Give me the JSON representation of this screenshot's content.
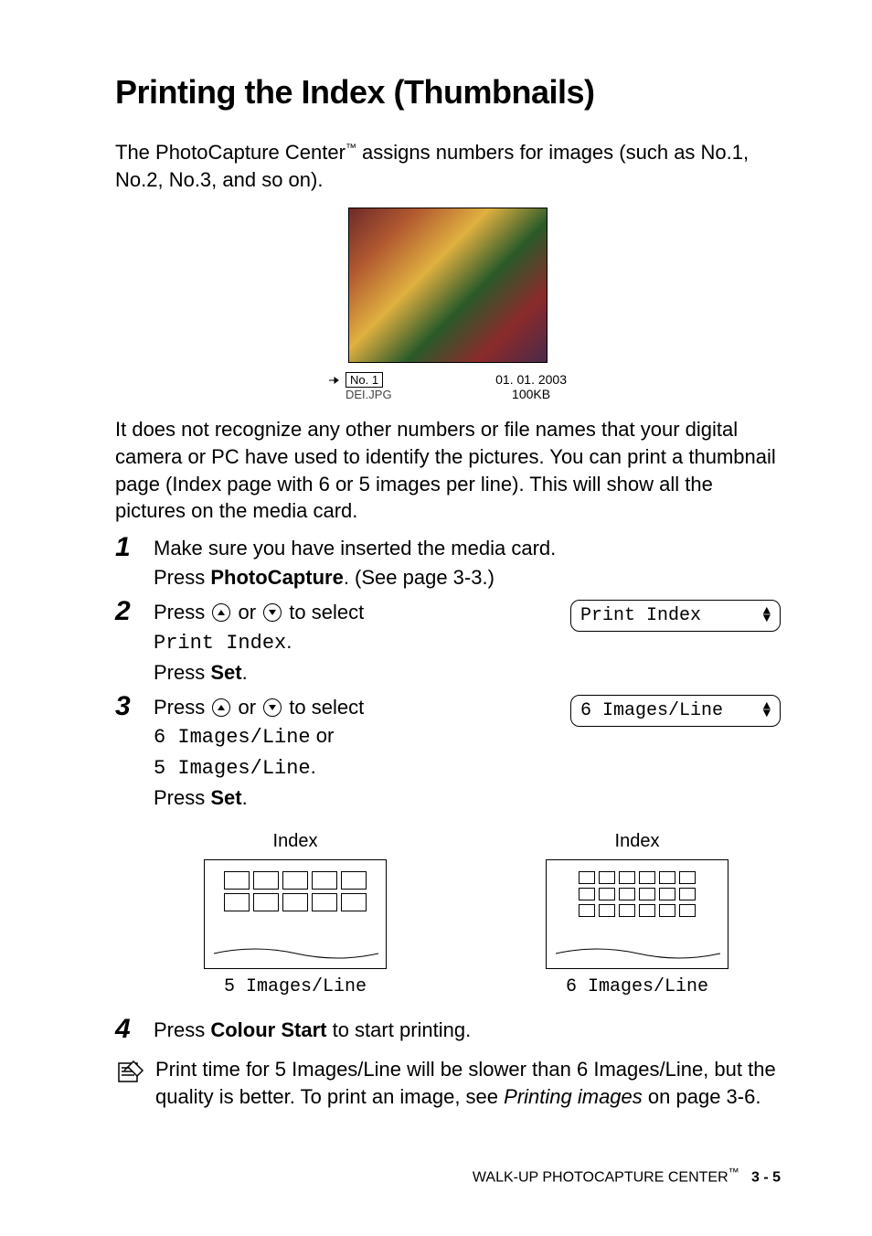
{
  "title": "Printing the Index (Thumbnails)",
  "intro": {
    "prefix": "The PhotoCapture Center",
    "tm": "™",
    "suffix": " assigns numbers for images (such as No.1, No.2, No.3, and so on)."
  },
  "photo_meta": {
    "no_label": "No. 1",
    "filename": "DEI.JPG",
    "date": "01. 01. 2003",
    "size": "100KB"
  },
  "para2": "It does not recognize any other numbers or file names that your digital camera or PC have used to identify the pictures. You can print a thumbnail page (Index page with 6 or 5 images per line). This will show all the pictures on the media card.",
  "steps": {
    "s1": {
      "num": "1",
      "line1": "Make sure you have inserted the media card.",
      "line2a": "Press ",
      "line2b": "PhotoCapture",
      "line2c": ". (See page 3-3.)"
    },
    "s2": {
      "num": "2",
      "press": "Press ",
      "or": " or ",
      "toselect": " to select",
      "mono": "Print Index",
      "period": ".",
      "press_set_a": "Press ",
      "press_set_b": "Set",
      "press_set_c": ".",
      "lcd": "Print Index"
    },
    "s3": {
      "num": "3",
      "press": "Press ",
      "or": " or ",
      "toselect": " to select",
      "mono6": "6 Images/Line",
      "or_text": " or",
      "mono5": "5 Images/Line",
      "period": ".",
      "press_set_a": "Press ",
      "press_set_b": "Set",
      "press_set_c": ".",
      "lcd": "6 Images/Line"
    },
    "s4": {
      "num": "4",
      "a": "Press ",
      "b": "Colour Start",
      "c": " to start printing."
    }
  },
  "diagrams": {
    "top": "Index",
    "cap5": "5 Images/Line",
    "cap6": "6 Images/Line"
  },
  "note": {
    "a": "Print time for 5 Images/Line will be slower than 6 Images/Line, but the quality is better. To print an image, see ",
    "b": "Printing images",
    "c": " on page 3-6."
  },
  "footer": {
    "label": "WALK-UP PHOTOCAPTURE CENTER",
    "tm": "™",
    "page": "3 - 5"
  }
}
